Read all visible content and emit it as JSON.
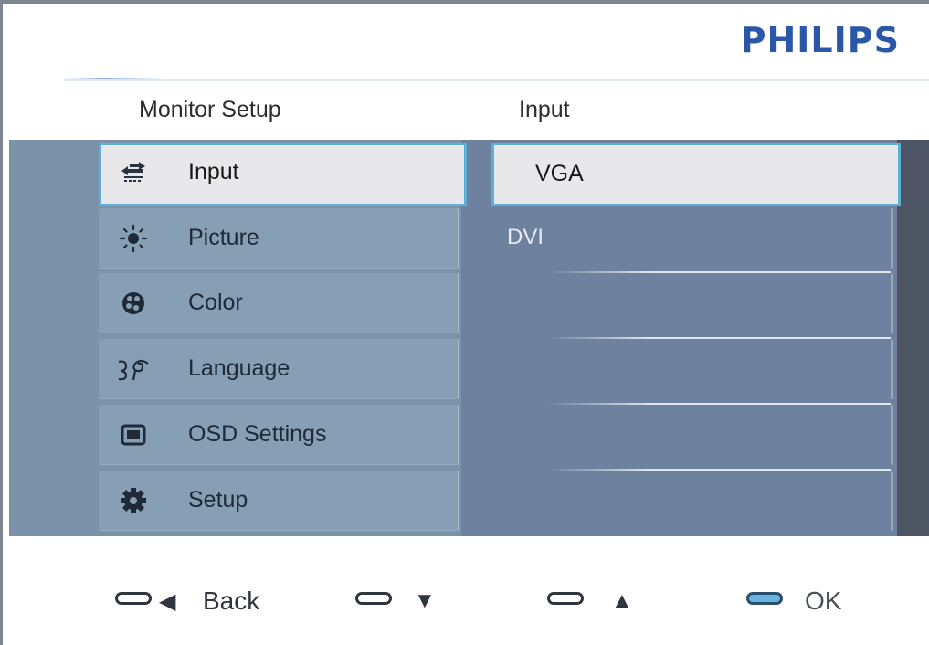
{
  "brand": "PHILIPS",
  "headers": {
    "left": "Monitor Setup",
    "right": "Input"
  },
  "menu": [
    {
      "label": "Input",
      "icon": "input-arrows-icon",
      "selected": true
    },
    {
      "label": "Picture",
      "icon": "sun-icon",
      "selected": false
    },
    {
      "label": "Color",
      "icon": "palette-icon",
      "selected": false
    },
    {
      "label": "Language",
      "icon": "language-icon",
      "selected": false
    },
    {
      "label": "OSD Settings",
      "icon": "screen-icon",
      "selected": false
    },
    {
      "label": "Setup",
      "icon": "gear-icon",
      "selected": false
    }
  ],
  "submenu": [
    {
      "label": "VGA",
      "selected": true
    },
    {
      "label": "DVI",
      "selected": false
    }
  ],
  "footer": {
    "back": "Back",
    "down": "▼",
    "up": "▲",
    "ok": "OK"
  },
  "colors": {
    "brand": "#2a57a8",
    "panel": "#7b93a9",
    "right_panel": "#6e829f",
    "highlight_border": "#5cb0d8",
    "selected_bg": "#e8e8ea"
  }
}
